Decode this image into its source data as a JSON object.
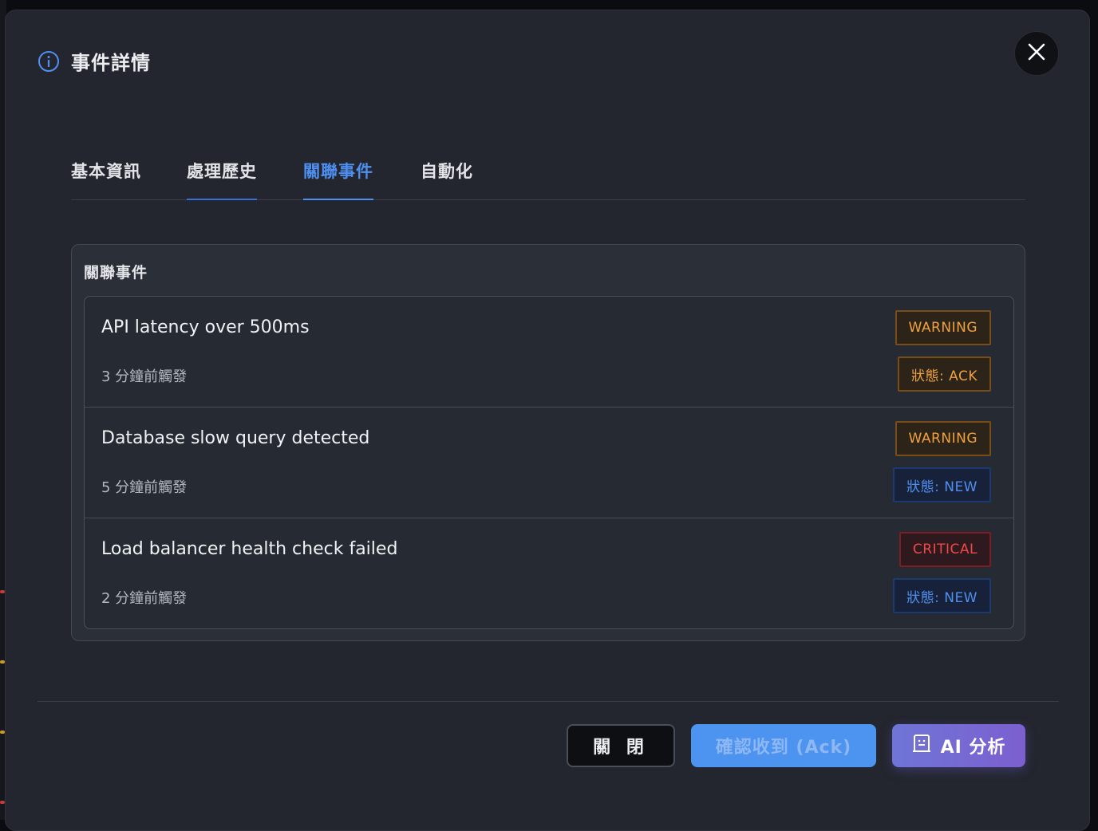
{
  "dialog": {
    "title": "事件詳情",
    "close_icon": "close-icon",
    "info_icon": "info-icon"
  },
  "tabs": [
    {
      "label": "基本資訊",
      "active": false
    },
    {
      "label": "處理歷史",
      "active": false
    },
    {
      "label": "關聯事件",
      "active": true
    },
    {
      "label": "自動化",
      "active": false
    }
  ],
  "related_events": {
    "title": "關聯事件",
    "items": [
      {
        "title": "API latency over 500ms",
        "time": "3 分鐘前觸發",
        "severity": "WARNING",
        "status": "狀態: ACK"
      },
      {
        "title": "Database slow query detected",
        "time": "5 分鐘前觸發",
        "severity": "WARNING",
        "status": "狀態: NEW"
      },
      {
        "title": "Load balancer health check failed",
        "time": "2 分鐘前觸發",
        "severity": "CRITICAL",
        "status": "狀態: NEW"
      }
    ]
  },
  "footer": {
    "close_label": "關 閉",
    "ack_label": "確認收到 (Ack)",
    "ai_label": "AI 分析",
    "ai_icon": "robot-icon"
  },
  "colors": {
    "accent": "#4f8ff0",
    "warning": "#f0a040",
    "critical": "#f04848",
    "background": "#23262e"
  }
}
